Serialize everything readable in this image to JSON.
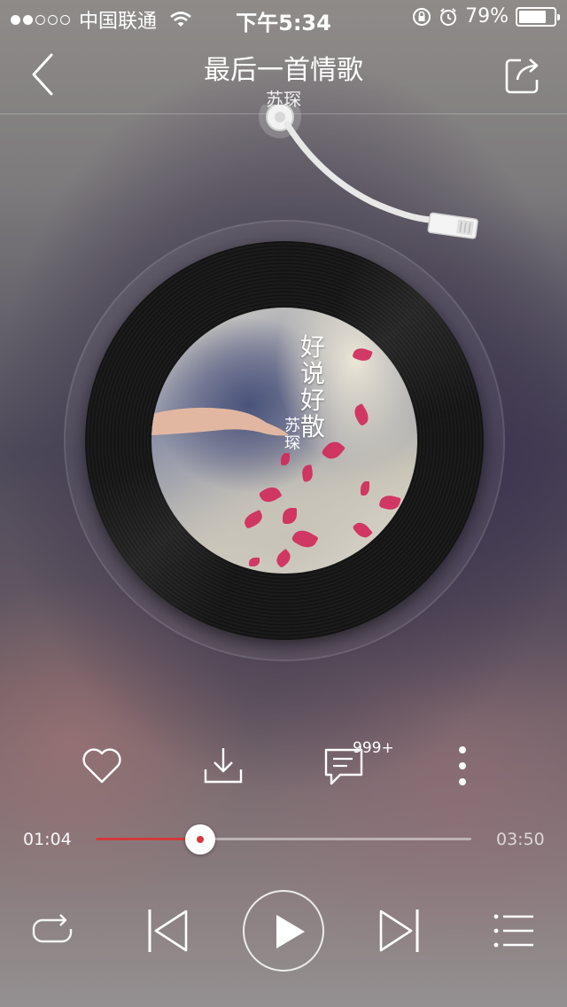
{
  "status_bar": {
    "carrier": "中国联通",
    "signal_strength": 2,
    "time": "下午5:34",
    "battery_percent": "79%",
    "battery_level": 0.79
  },
  "header": {
    "title": "最后一首情歌",
    "artist": "苏琛"
  },
  "album": {
    "cover_title": "好说好散",
    "cover_artist": "苏琛"
  },
  "actions": {
    "comment_count": "999+"
  },
  "player": {
    "current_time": "01:04",
    "total_time": "03:50",
    "progress": 0.278
  },
  "colors": {
    "accent": "#d23a3a"
  },
  "icons": {
    "back": "chevron-left-icon",
    "share": "share-icon",
    "like": "heart-icon",
    "download": "download-icon",
    "comment": "comment-icon",
    "more": "more-vertical-icon",
    "repeat": "repeat-icon",
    "prev": "skip-previous-icon",
    "play": "play-icon",
    "next": "skip-next-icon",
    "playlist": "playlist-icon"
  }
}
